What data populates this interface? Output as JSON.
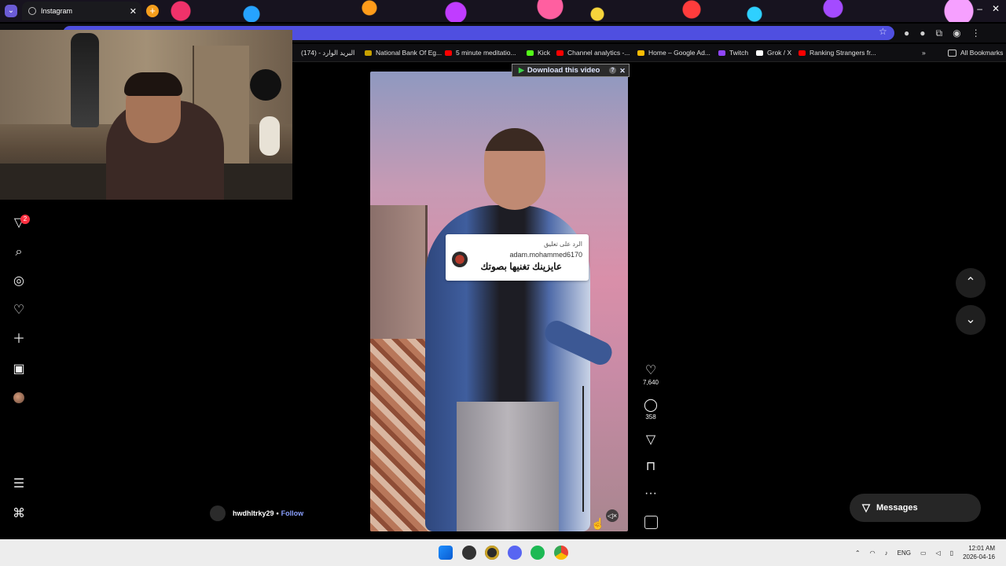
{
  "browser": {
    "tab_title": "Instagram",
    "tab_close": "✕",
    "new_tab": "+",
    "window_minimize": "–",
    "window_close": "✕",
    "star": "☆"
  },
  "bookmarks": [
    {
      "label": "البريد الوارد - (174)",
      "color": "#ffffff"
    },
    {
      "label": "National Bank Of Eg...",
      "color": "#c8a100"
    },
    {
      "label": "5 minute meditatio...",
      "color": "#ff0000"
    },
    {
      "label": "Kick",
      "color": "#53fc18"
    },
    {
      "label": "Channel analytics -...",
      "color": "#ff0000"
    },
    {
      "label": "Home – Google Ad...",
      "color": "#fbbc04"
    },
    {
      "label": "Twitch",
      "color": "#9146ff"
    },
    {
      "label": "Grok / X",
      "color": "#ffffff"
    },
    {
      "label": "Ranking Strangers fr...",
      "color": "#ff0000"
    }
  ],
  "bookmarks_overflow": "»",
  "all_bookmarks": "All Bookmarks",
  "sidebar": {
    "notifications_badge": "2",
    "icons": [
      "filter-icon",
      "search-icon",
      "explore-icon",
      "heart-icon",
      "plus-icon",
      "dashboard-icon",
      "profile-icon"
    ],
    "menu_icon": "☰",
    "meta_icon": "⌘"
  },
  "reel": {
    "download_label": "Download this video",
    "download_help": "?",
    "download_close": "✕",
    "caption": {
      "reply_label": "الرد على تعليق",
      "username": "adam.mohammed6170",
      "text": "عايزينك تغنيها بصوتك"
    },
    "author": "hwdhltrky29",
    "dot": "•",
    "follow": "Follow",
    "mute_icon": "🔇"
  },
  "actions": {
    "likes": "7,640",
    "comments": "358"
  },
  "nav": {
    "up": "⌃",
    "down": "⌄"
  },
  "messages_label": "Messages",
  "taskbar": {
    "lang": "ENG",
    "time": "12:01 AM",
    "date": "2026-04-16"
  }
}
